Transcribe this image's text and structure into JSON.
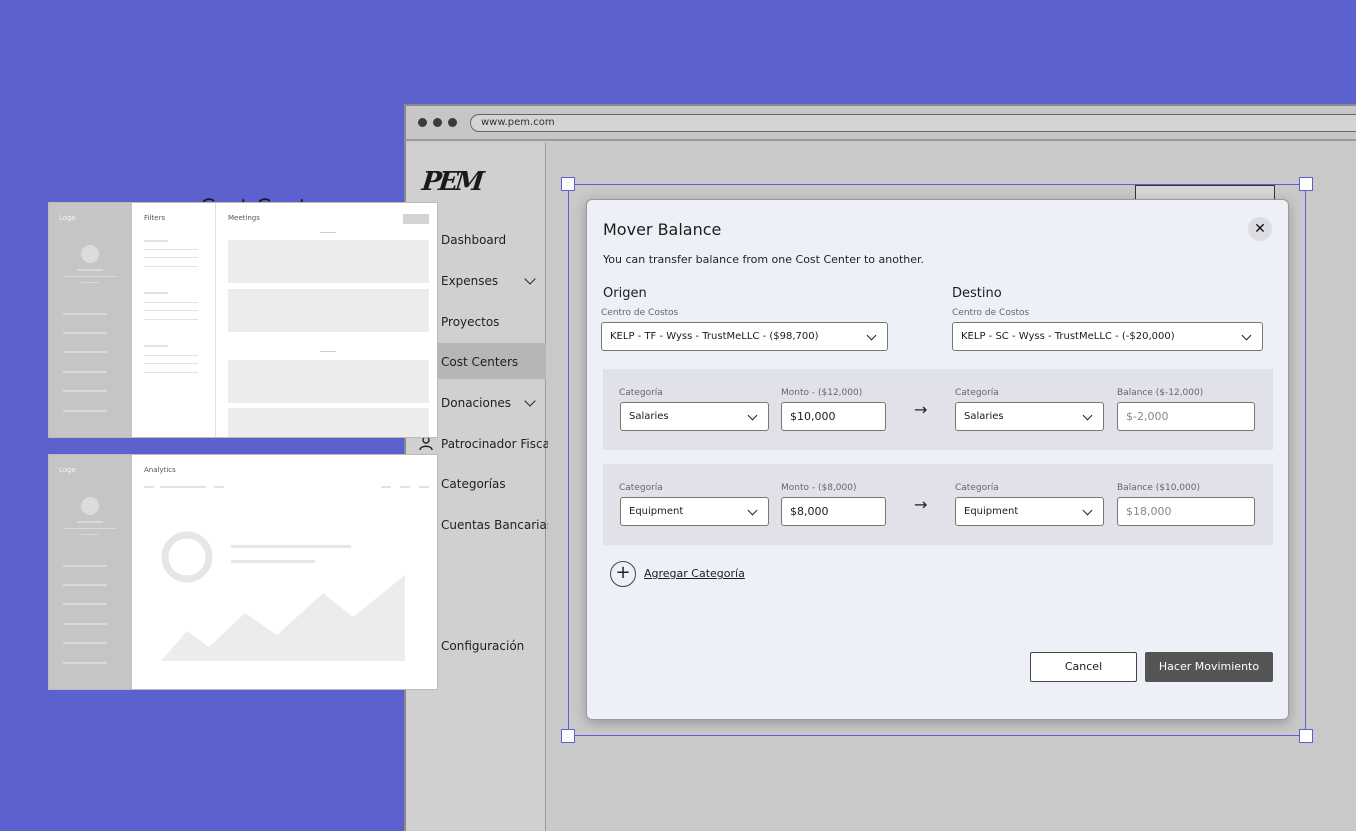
{
  "browser": {
    "url": "www.pem.com"
  },
  "sidebar": {
    "logo": "PEM",
    "items": [
      {
        "label": "Dashboard"
      },
      {
        "label": "Expenses"
      },
      {
        "label": "Proyectos"
      },
      {
        "label": "Cost Centers"
      },
      {
        "label": "Donaciones"
      },
      {
        "label": "Patrocinador Fiscal"
      },
      {
        "label": "Categorías"
      },
      {
        "label": "Cuentas Bancarias"
      },
      {
        "label": "Configuración"
      }
    ]
  },
  "page": {
    "title": "Cost Centers"
  },
  "wireframes": {
    "one": {
      "logo": "Logo",
      "filters": "Filters",
      "meetings": "Meetings"
    },
    "two": {
      "logo": "Logo",
      "analytics": "Analytics"
    }
  },
  "modal": {
    "title": "Mover Balance",
    "description": "You can transfer balance from one Cost Center to another.",
    "origin": {
      "heading": "Origen",
      "label": "Centro de Costos",
      "value": "KELP - TF - Wyss - TrustMeLLC - ($98,700)"
    },
    "destination": {
      "heading": "Destino",
      "label": "Centro de Costos",
      "value": "KELP - SC - Wyss - TrustMeLLC - (-$20,000)"
    },
    "rows": [
      {
        "cat_label": "Categoría",
        "cat_value": "Salaries",
        "amount_label": "Monto - ($12,000)",
        "amount_value": "$10,000",
        "dest_cat_label": "Categoría",
        "dest_cat_value": "Salaries",
        "balance_label": "Balance ($-12,000)",
        "balance_value": "$-2,000"
      },
      {
        "cat_label": "Categoría",
        "cat_value": "Equipment",
        "amount_label": "Monto - ($8,000)",
        "amount_value": "$8,000",
        "dest_cat_label": "Categoría",
        "dest_cat_value": "Equipment",
        "balance_label": "Balance ($10,000)",
        "balance_value": "$18,000"
      }
    ],
    "add_category": "Agregar Categoría",
    "cancel": "Cancel",
    "submit": "Hacer Movimiento"
  }
}
